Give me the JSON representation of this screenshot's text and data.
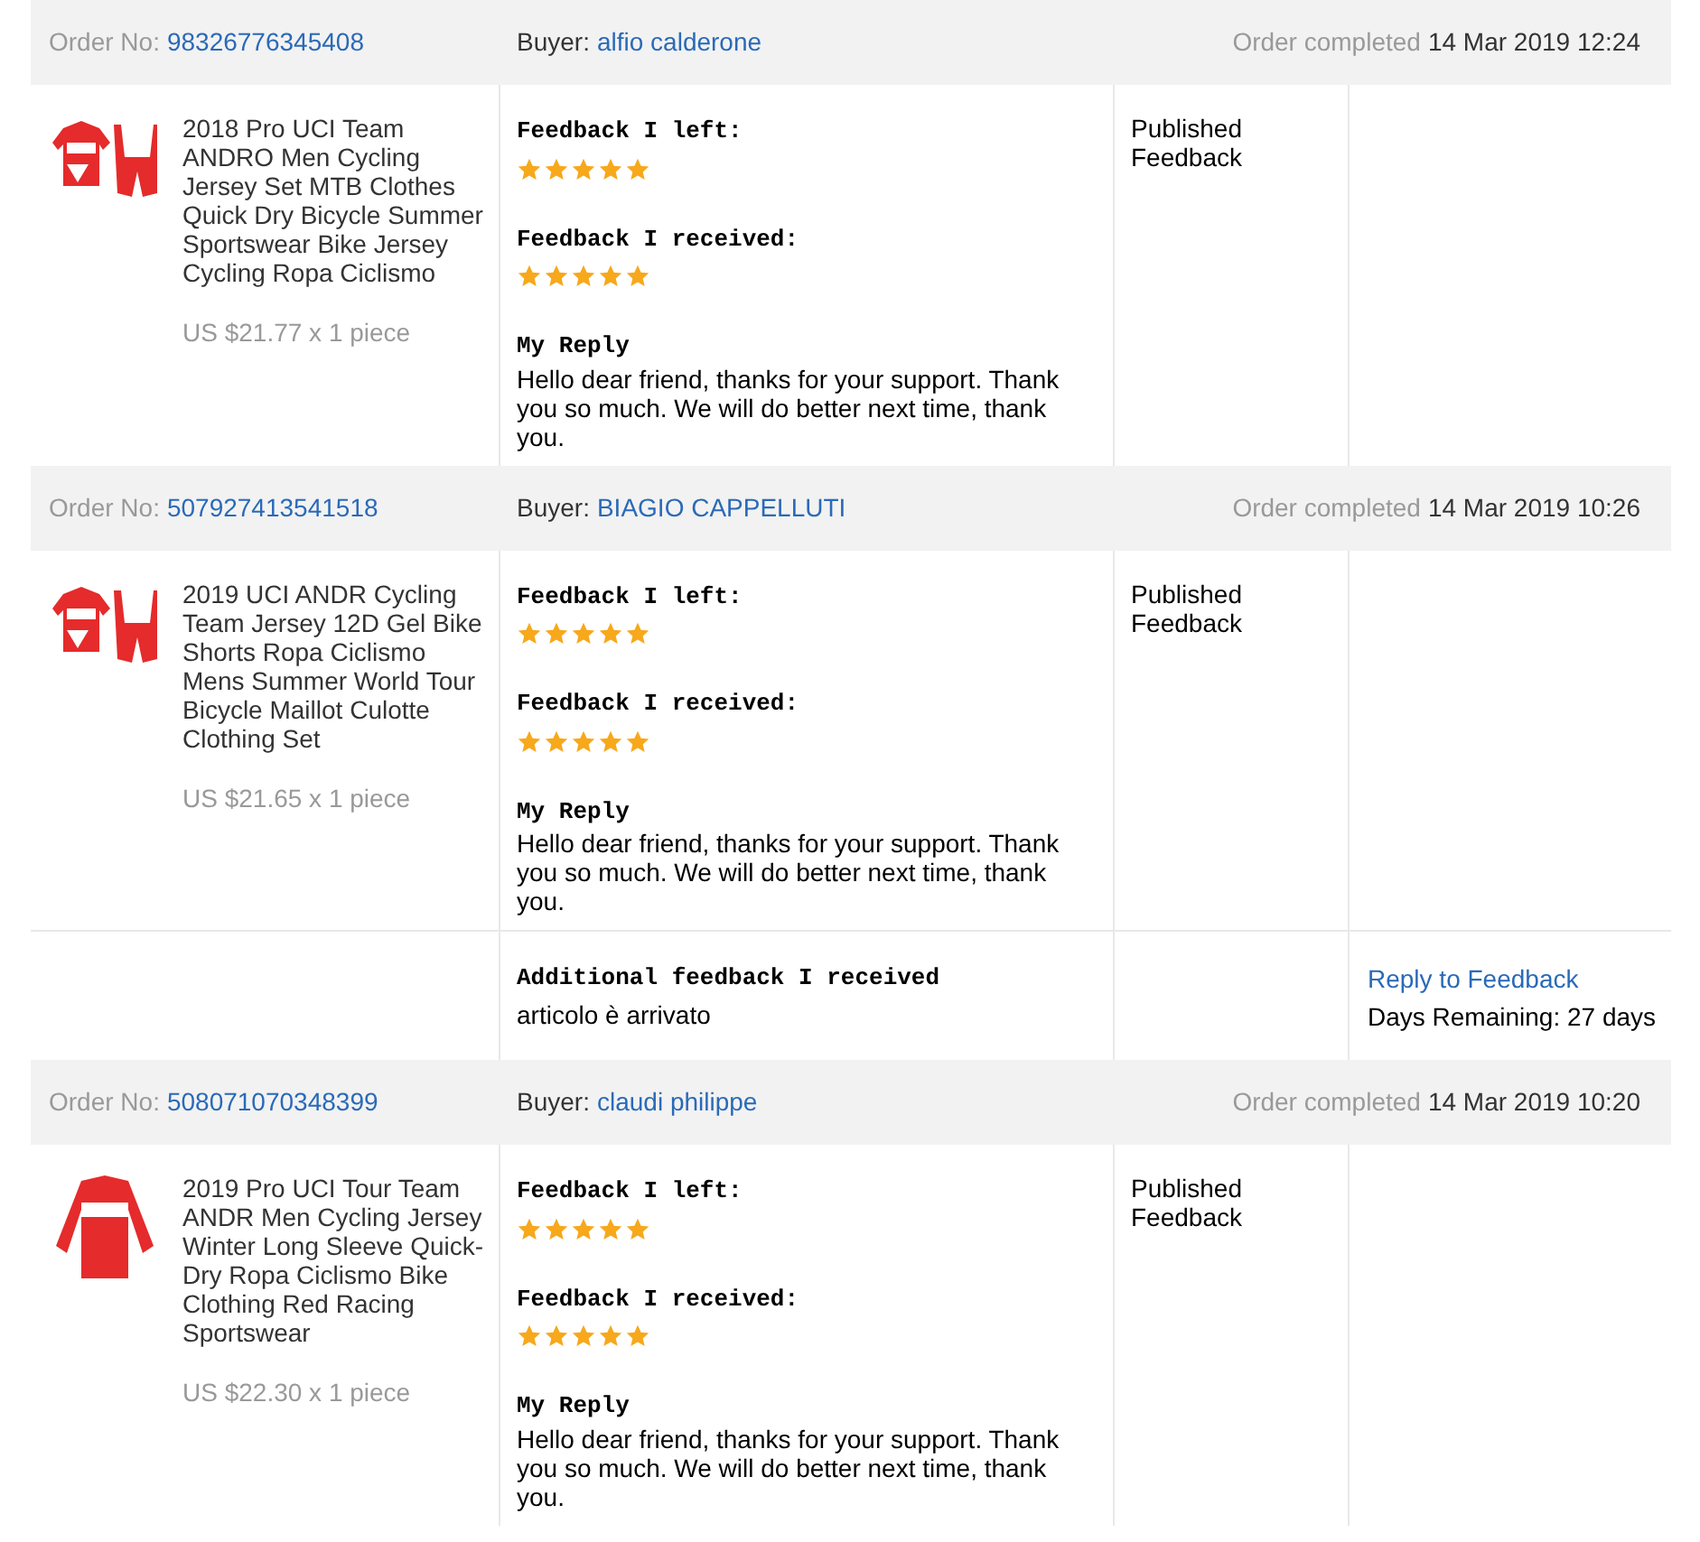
{
  "orders": [
    {
      "order_label": "Order No:",
      "order_no": "98326776345408",
      "buyer_label": "Buyer:",
      "buyer": "alfio calderone",
      "completed_label": "Order completed",
      "completed": "14 Mar 2019 12:24",
      "product": {
        "title": "2018 Pro UCI Team ANDRO Men Cycling Jersey Set MTB Clothes Quick Dry Bicycle Summer Sportswear Bike Jersey Cycling Ropa Ciclismo",
        "price": "US $21.77 x 1 piece",
        "kind": "set"
      },
      "left": {
        "label": "Feedback I left:",
        "stars": 5
      },
      "received": {
        "label": "Feedback I received:",
        "stars": 5
      },
      "reply_label": "My Reply",
      "reply": "Hello dear friend, thanks for your support. Thank you so much. We will do better next time, thank you.",
      "status": "Published Feedback"
    },
    {
      "order_label": "Order No:",
      "order_no": "507927413541518",
      "buyer_label": "Buyer:",
      "buyer": "BIAGIO CAPPELLUTI",
      "completed_label": "Order completed",
      "completed": "14 Mar 2019 10:26",
      "product": {
        "title": "2019 UCI ANDR Cycling Team Jersey 12D Gel Bike Shorts Ropa Ciclismo Mens Summer World Tour Bicycle Maillot Culotte Clothing Set",
        "price": "US $21.65 x 1 piece",
        "kind": "set"
      },
      "left": {
        "label": "Feedback I left:",
        "stars": 5
      },
      "received": {
        "label": "Feedback I received:",
        "stars": 5
      },
      "reply_label": "My Reply",
      "reply": "Hello dear friend, thanks for your support. Thank you so much. We will do better next time, thank you.",
      "status": "Published Feedback",
      "additional": {
        "label": "Additional feedback I received",
        "text": "articolo è arrivato",
        "action": "Reply to Feedback",
        "remaining": "Days Remaining: 27 days"
      }
    },
    {
      "order_label": "Order No:",
      "order_no": "508071070348399",
      "buyer_label": "Buyer:",
      "buyer": "claudi philippe",
      "completed_label": "Order completed",
      "completed": "14 Mar 2019 10:20",
      "product": {
        "title": "2019 Pro UCI Tour Team ANDR Men Cycling Jersey Winter Long Sleeve Quick-Dry Ropa Ciclismo Bike Clothing Red Racing Sportswear",
        "price": "US $22.30 x 1 piece",
        "kind": "longsleeve"
      },
      "left": {
        "label": "Feedback I left:",
        "stars": 5
      },
      "received": {
        "label": "Feedback I received:",
        "stars": 5
      },
      "reply_label": "My Reply",
      "reply": "Hello dear friend, thanks for your support. Thank you so much. We will do better next time, thank you.",
      "status": "Published Feedback"
    }
  ]
}
